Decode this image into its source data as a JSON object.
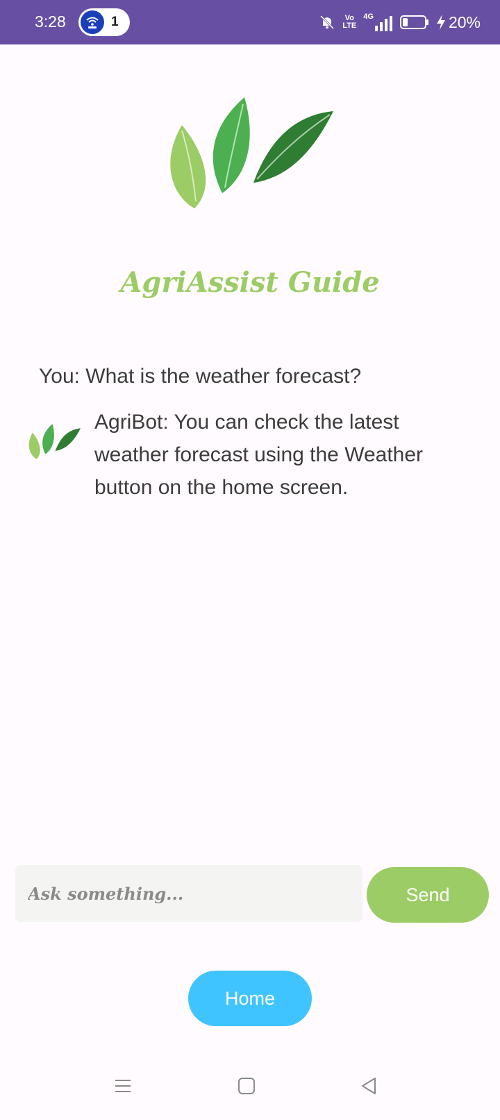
{
  "status": {
    "time": "3:28",
    "hotspot_count": "1",
    "battery": "20%",
    "network_top": "Vo",
    "network_bottom": "LTE",
    "signal_label": "4G",
    "icons": [
      "hotspot-icon",
      "bell-off-icon",
      "volte-icon",
      "signal-icon",
      "battery-icon",
      "charging-icon"
    ]
  },
  "app": {
    "title": "AgriAssist Guide",
    "logo": "leaves-logo",
    "colors": {
      "title": "#9CCC65",
      "status_bar": "#6750A4",
      "send": "#9CCC65",
      "home": "#40C4FF"
    }
  },
  "chat": {
    "messages": [
      {
        "sender": "user",
        "text": "You: What is the weather forecast?"
      },
      {
        "sender": "bot",
        "text": "AgriBot: You can check the latest weather forecast using the Weather button on the home screen."
      }
    ]
  },
  "input": {
    "placeholder": "Ask something...",
    "value": ""
  },
  "buttons": {
    "send": "Send",
    "home": "Home"
  },
  "nav": {
    "icons": [
      "menu-icon",
      "home-square-icon",
      "back-icon"
    ]
  }
}
